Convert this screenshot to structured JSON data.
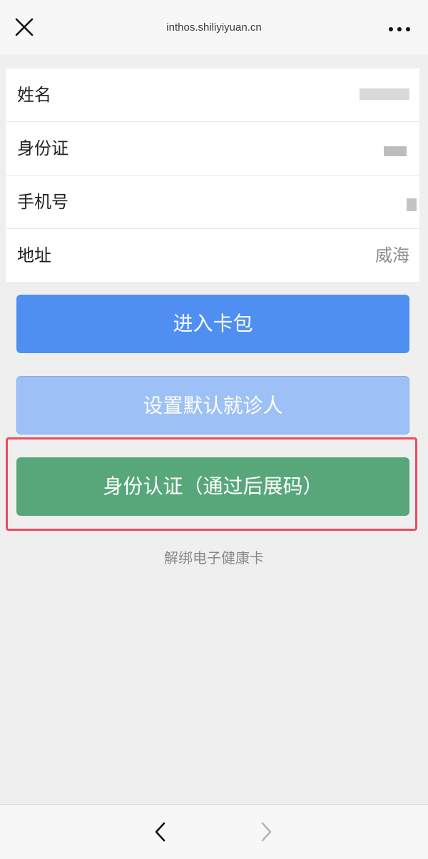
{
  "browser": {
    "url": "inthos.shiliyiyuan.cn",
    "close_icon": "close-icon",
    "more_icon": "more-dots-icon",
    "back_icon": "chevron-left-icon",
    "forward_icon": "chevron-right-icon"
  },
  "info": {
    "name_label": "姓名",
    "id_label": "身份证",
    "phone_label": "手机号",
    "address_label": "地址",
    "address_value": "威海"
  },
  "actions": {
    "wallet_label": "进入卡包",
    "default_label": "设置默认就诊人",
    "verify_label": "身份认证（通过后展码）",
    "unbind_label": "解绑电子健康卡"
  },
  "colors": {
    "primary_blue": "#4f8ff2",
    "light_blue": "#9dc1f6",
    "green": "#58a77b",
    "highlight_red": "#ee4b5f"
  }
}
